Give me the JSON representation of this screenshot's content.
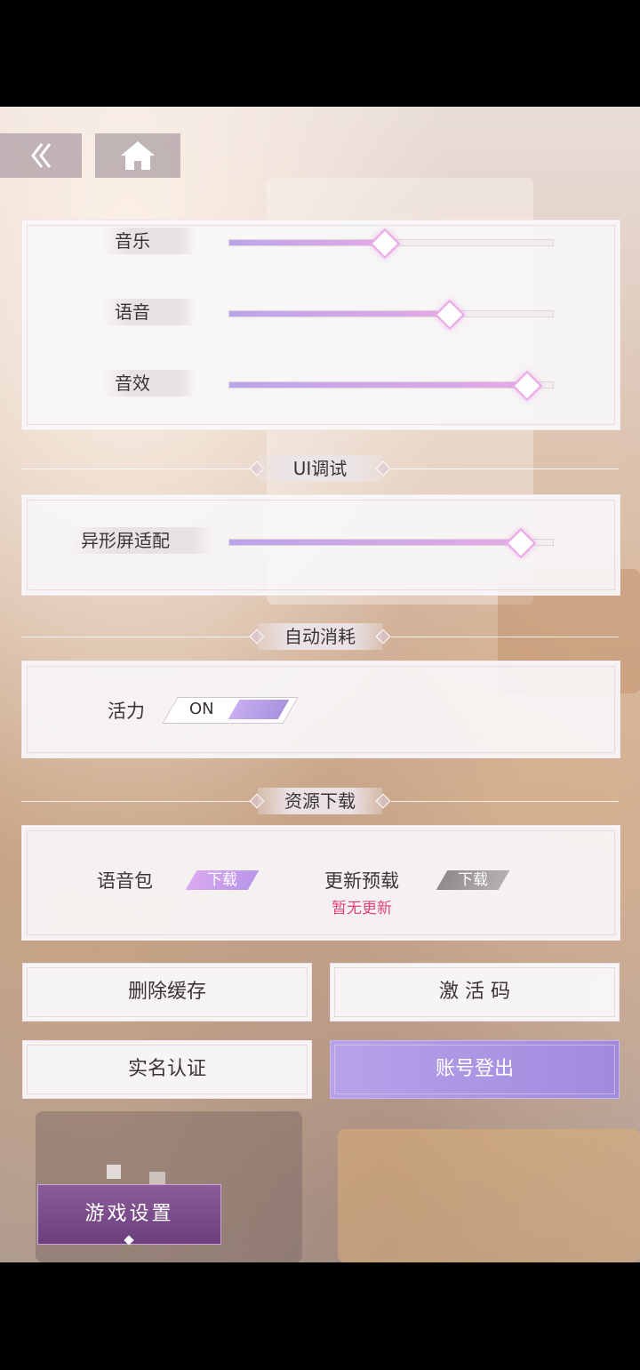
{
  "colors": {
    "accent_purple": "#a993e0",
    "slider_fill_start": "#b9a5ea",
    "slider_fill_end": "#e5a9e6",
    "update_status": "#e0467a",
    "tab_active": "#7a4d88"
  },
  "nav": {
    "back_icon": "double-chevron-left-icon",
    "home_icon": "home-icon"
  },
  "audio": {
    "music": {
      "label": "音乐",
      "value": 0.48
    },
    "voice": {
      "label": "语音",
      "value": 0.68
    },
    "sfx": {
      "label": "音效",
      "value": 0.92
    }
  },
  "ui_debug": {
    "header": "UI调试",
    "notch": {
      "label": "异形屏适配",
      "value": 0.9
    }
  },
  "auto_consume": {
    "header": "自动消耗",
    "stamina": {
      "label": "活力",
      "toggle_text": "ON"
    }
  },
  "downloads": {
    "header": "资源下载",
    "voice_pack": {
      "label": "语音包",
      "button": "下载"
    },
    "update_preload": {
      "label": "更新预载",
      "button": "下载",
      "status": "暂无更新"
    }
  },
  "actions": {
    "clear_cache": "删除缓存",
    "activation_code": "激 活 码",
    "real_name": "实名认证",
    "logout": "账号登出"
  },
  "tab": {
    "game_settings": "游戏设置"
  }
}
